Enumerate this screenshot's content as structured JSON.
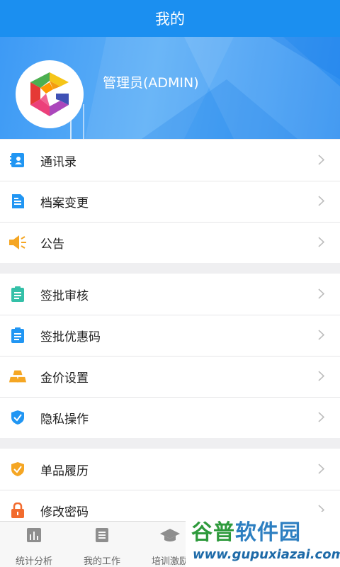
{
  "header": {
    "title": "我的"
  },
  "profile": {
    "name": "管理员(ADMIN)"
  },
  "groups": [
    {
      "items": [
        {
          "label": "通讯录",
          "icon": "contacts-icon",
          "color": "#2196f3"
        },
        {
          "label": "档案变更",
          "icon": "document-icon",
          "color": "#2196f3"
        },
        {
          "label": "公告",
          "icon": "megaphone-icon",
          "color": "#f5a623"
        }
      ]
    },
    {
      "items": [
        {
          "label": "签批审核",
          "icon": "clipboard-check-icon",
          "color": "#34c0a8"
        },
        {
          "label": "签批优惠码",
          "icon": "clipboard-icon",
          "color": "#2196f3"
        },
        {
          "label": "金价设置",
          "icon": "gold-bars-icon",
          "color": "#f5a623"
        },
        {
          "label": "隐私操作",
          "icon": "shield-check-icon",
          "color": "#2196f3"
        }
      ]
    },
    {
      "items": [
        {
          "label": "单品履历",
          "icon": "shield-check-icon",
          "color": "#f5a623"
        },
        {
          "label": "修改密码",
          "icon": "lock-icon",
          "color": "#f26b2e"
        }
      ]
    }
  ],
  "tabbar": [
    {
      "label": "统计分析",
      "icon": "bar-chart-icon"
    },
    {
      "label": "我的工作",
      "icon": "document-list-icon"
    },
    {
      "label": "培训激励",
      "icon": "graduation-cap-icon"
    }
  ],
  "watermark": {
    "name_green": "谷普",
    "name_blue": "软件园",
    "url": "www.gupuxiazai.com"
  },
  "colors": {
    "primary": "#1b8ff0",
    "accent_orange": "#f5a623",
    "background": "#efeff1"
  }
}
